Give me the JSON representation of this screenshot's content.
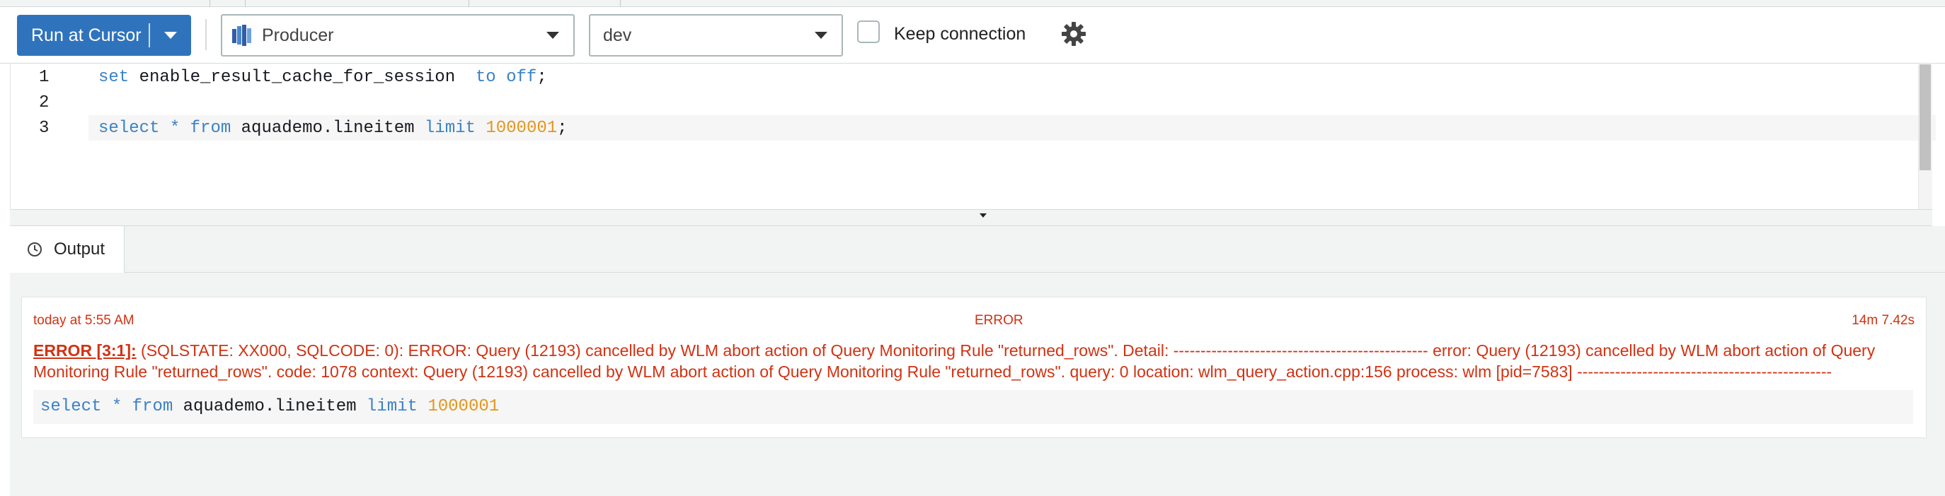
{
  "toolbar": {
    "run_label": "Run at Cursor",
    "database_select": "Producer",
    "schema_select": "dev",
    "keep_connection_label": "Keep connection",
    "keep_connection_checked": false
  },
  "editor": {
    "lines": [
      {
        "number": "1",
        "tokens": [
          {
            "t": "set",
            "c": "kw"
          },
          {
            "t": " enable_result_cache_for_session  ",
            "c": ""
          },
          {
            "t": "to",
            "c": "kw"
          },
          {
            "t": " ",
            "c": ""
          },
          {
            "t": "off",
            "c": "kw"
          },
          {
            "t": ";",
            "c": ""
          }
        ]
      },
      {
        "number": "2",
        "tokens": []
      },
      {
        "number": "3",
        "tokens": [
          {
            "t": "select",
            "c": "kw"
          },
          {
            "t": " ",
            "c": ""
          },
          {
            "t": "*",
            "c": "kw"
          },
          {
            "t": " ",
            "c": ""
          },
          {
            "t": "from",
            "c": "kw"
          },
          {
            "t": " aquademo.lineitem ",
            "c": ""
          },
          {
            "t": "limit",
            "c": "kw"
          },
          {
            "t": " ",
            "c": ""
          },
          {
            "t": "1000001",
            "c": "num"
          },
          {
            "t": ";",
            "c": ""
          }
        ]
      }
    ]
  },
  "output": {
    "tab_label": "Output",
    "entry": {
      "timestamp": "today at 5:55 AM",
      "status": "ERROR",
      "duration": "14m 7.42s",
      "error_link": "ERROR [3:1]:",
      "message": " (SQLSTATE: XX000, SQLCODE: 0): ERROR: Query (12193) cancelled by WLM abort action of Query Monitoring Rule \"returned_rows\". Detail: ----------------------------------------------- error: Query (12193) cancelled by WLM abort action of Query Monitoring Rule \"returned_rows\". code: 1078 context: Query (12193) cancelled by WLM abort action of Query Monitoring Rule \"returned_rows\". query: 0 location: wlm_query_action.cpp:156 process: wlm [pid=7583] -----------------------------------------------",
      "query_tokens": [
        {
          "t": "select",
          "c": "kw"
        },
        {
          "t": " ",
          "c": ""
        },
        {
          "t": "*",
          "c": "kw"
        },
        {
          "t": " ",
          "c": ""
        },
        {
          "t": "from",
          "c": "kw"
        },
        {
          "t": " aquademo.lineitem ",
          "c": ""
        },
        {
          "t": "limit",
          "c": "kw"
        },
        {
          "t": " ",
          "c": ""
        },
        {
          "t": "1000001",
          "c": "num"
        }
      ]
    }
  },
  "colors": {
    "accent": "#3073bd",
    "error": "#d13212",
    "keyword": "#3b82c4",
    "number": "#e5961b"
  },
  "icons": {
    "database": "database-icon",
    "settings": "gear-icon",
    "history": "clock-icon"
  }
}
